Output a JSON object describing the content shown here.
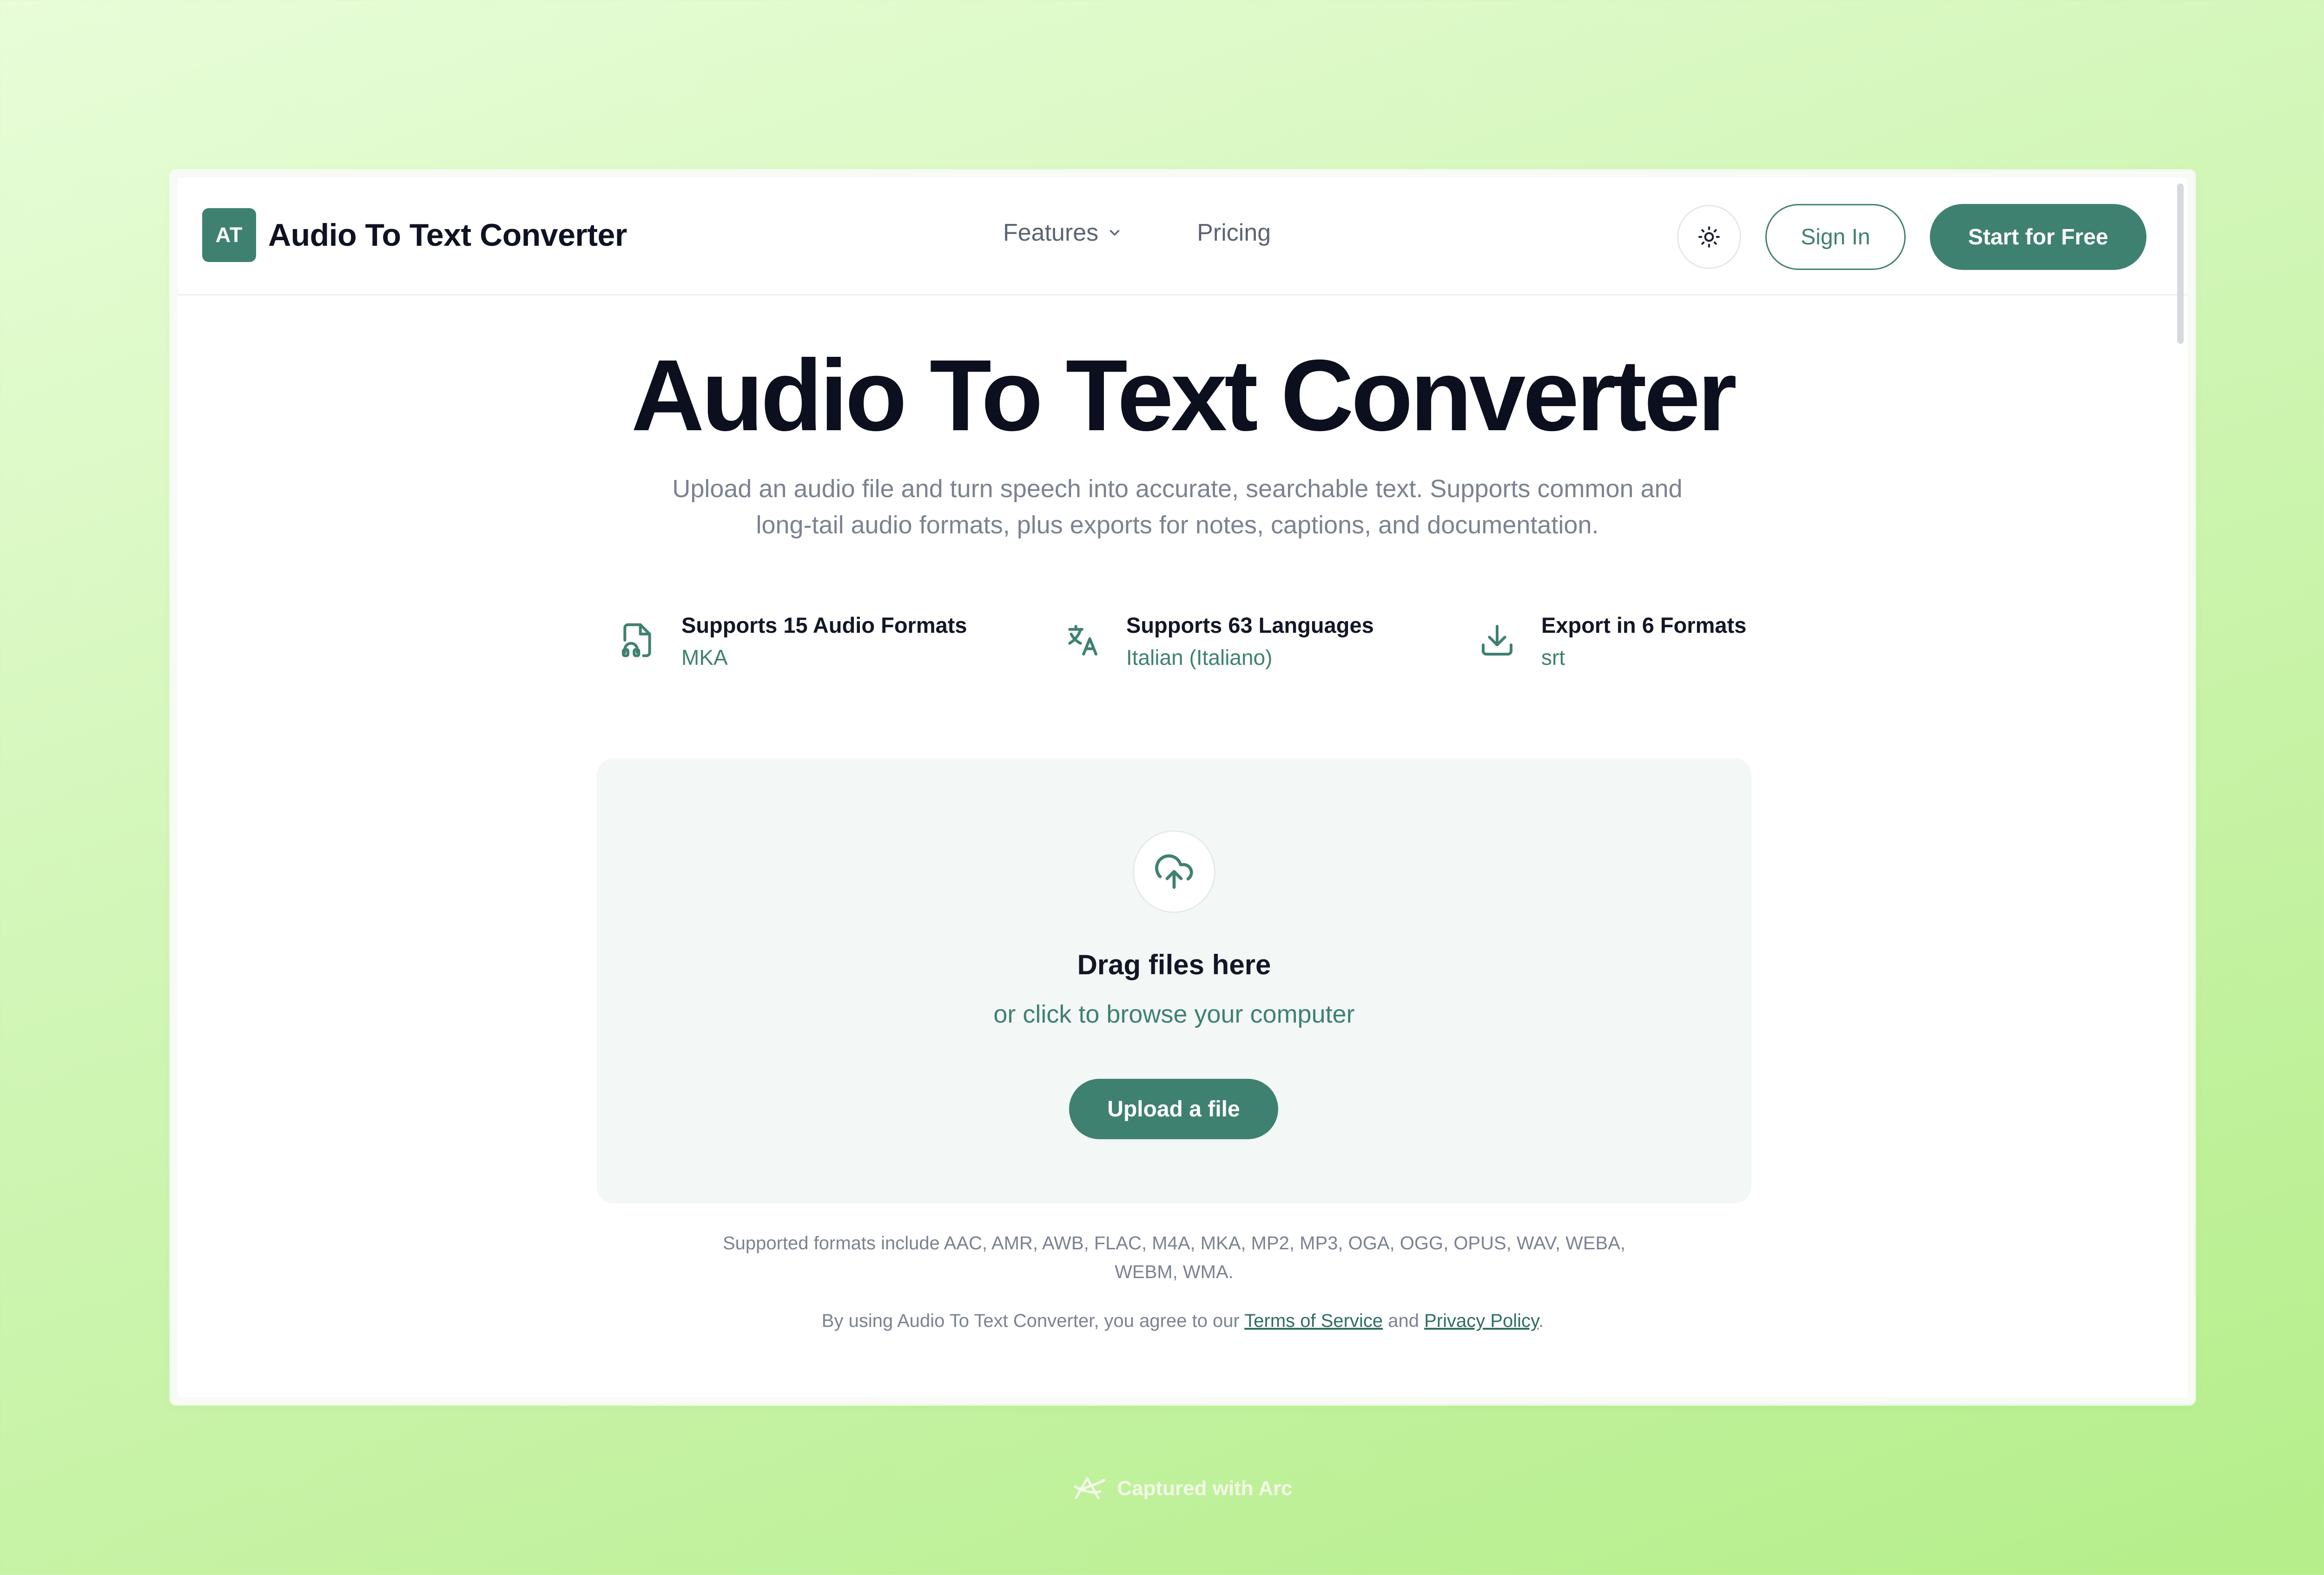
{
  "header": {
    "logo_initials": "AT",
    "brand_name": "Audio To Text Converter",
    "nav": {
      "features_label": "Features",
      "pricing_label": "Pricing"
    },
    "theme_icon": "sun-icon",
    "signin_label": "Sign In",
    "start_label": "Start for Free"
  },
  "hero": {
    "title": "Audio To Text Converter",
    "subtitle": "Upload an audio file and turn speech into accurate, searchable text. Supports common and long-tail audio formats, plus exports for notes, captions, and documentation."
  },
  "features": [
    {
      "icon": "audio-file-icon",
      "title": "Supports 15 Audio Formats",
      "value": "MKA"
    },
    {
      "icon": "translate-icon",
      "title": "Supports 63 Languages",
      "value": "Italian (Italiano)"
    },
    {
      "icon": "download-icon",
      "title": "Export in 6 Formats",
      "value": "srt"
    }
  ],
  "dropzone": {
    "icon": "cloud-upload-icon",
    "title": "Drag files here",
    "subtitle": "or click to browse your computer",
    "button_label": "Upload a file"
  },
  "footnote": {
    "formats": "Supported formats include AAC, AMR, AWB, FLAC, M4A, MKA, MP2, MP3, OGA, OGG, OPUS, WAV, WEBA, WEBM, WMA.",
    "legal_prefix": "By using Audio To Text Converter, you agree to our ",
    "terms_label": "Terms of Service",
    "legal_and": " and ",
    "privacy_label": "Privacy Policy",
    "legal_suffix": "."
  },
  "captured": {
    "icon": "arc-logo-icon",
    "text": "Captured with Arc"
  },
  "colors": {
    "accent": "#3f8170",
    "background_light": "#e8fdd8",
    "background_dark": "#b5ee8a",
    "text_muted": "#7b8291"
  }
}
